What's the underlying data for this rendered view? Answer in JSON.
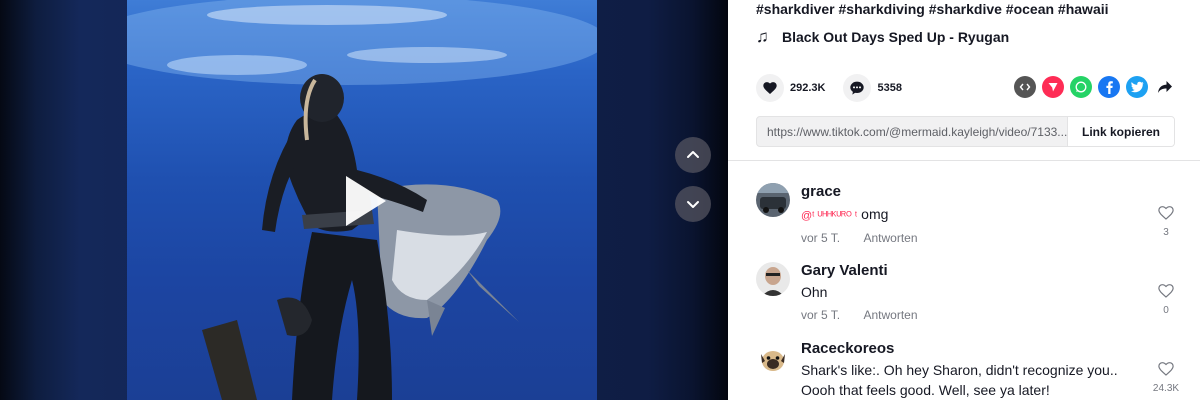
{
  "post": {
    "hashtags": "#sharkdiver #sharkdiving #sharkdive #ocean #hawaii",
    "music_icon": "music-note-icon",
    "music": "Black Out Days Sped Up - Ryugan",
    "likes": "292.3K",
    "comments": "5358",
    "link_url": "https://www.tiktok.com/@mermaid.kayleigh/video/7133...",
    "copy_link_label": "Link kopieren"
  },
  "share_icons": [
    "embed-icon",
    "send-icon",
    "whatsapp-icon",
    "facebook-icon",
    "twitter-icon",
    "share-arrow-icon"
  ],
  "colors": {
    "brand_red": "#fe2c55",
    "whatsapp": "#25d366",
    "facebook": "#1877f2",
    "twitter": "#1da1f2",
    "embed": "#555555",
    "ocean": "#2a64c6"
  },
  "comments": [
    {
      "user": "grace",
      "mention": "@ᵗ ᵁᴴᴴᴷᵁᴿᴼ ᵗ",
      "text": "omg",
      "time": "vor 5 T.",
      "reply": "Antworten",
      "likes": "3"
    },
    {
      "user": "Gary Valenti",
      "text": "Ohn",
      "time": "vor 5 T.",
      "reply": "Antworten",
      "likes": "0"
    },
    {
      "user": "Raceckoreos",
      "text": "Shark's like:. Oh hey Sharon, didn't recognize you..",
      "text2": "Oooh that feels good. Well, see ya later!",
      "likes": "24.3K"
    }
  ]
}
